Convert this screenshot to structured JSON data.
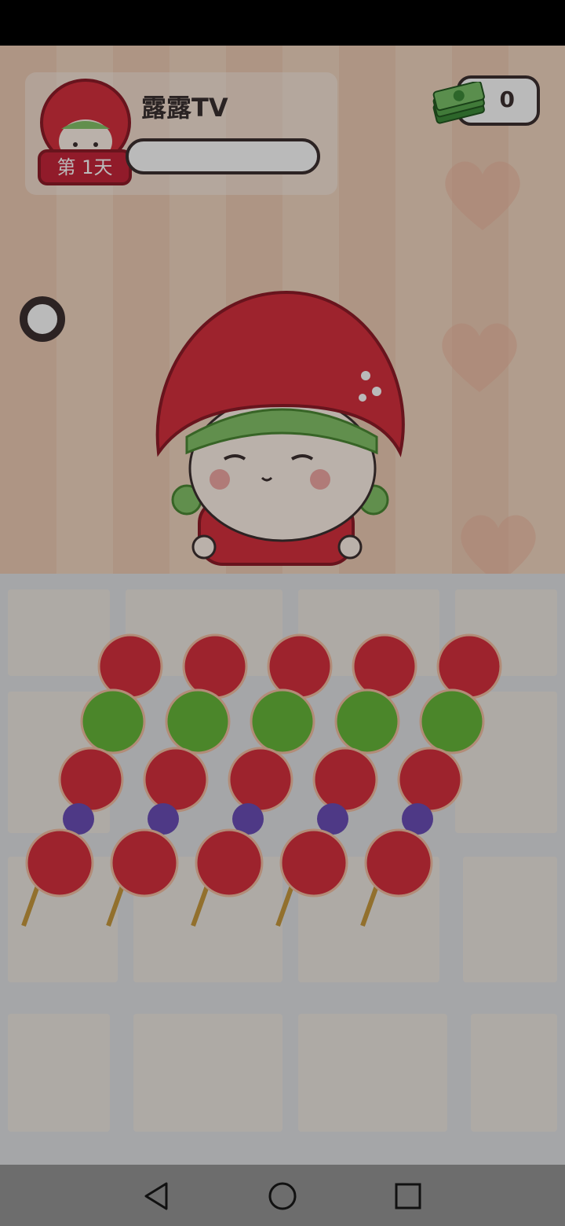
{
  "player": {
    "name": "露露TV",
    "day_label": "第 1天",
    "progress": 0
  },
  "currency": {
    "value": "0",
    "icon": "cash-stack-icon"
  },
  "controls": {
    "pause_icon": "pause-ring-icon"
  },
  "nav": {
    "back": "back-icon",
    "home": "home-icon",
    "recents": "recents-icon"
  },
  "colors": {
    "candy_red": "#d8303e",
    "candy_green": "#67b83a",
    "candy_purple": "#6b4fb8",
    "badge": "#c7263a"
  }
}
